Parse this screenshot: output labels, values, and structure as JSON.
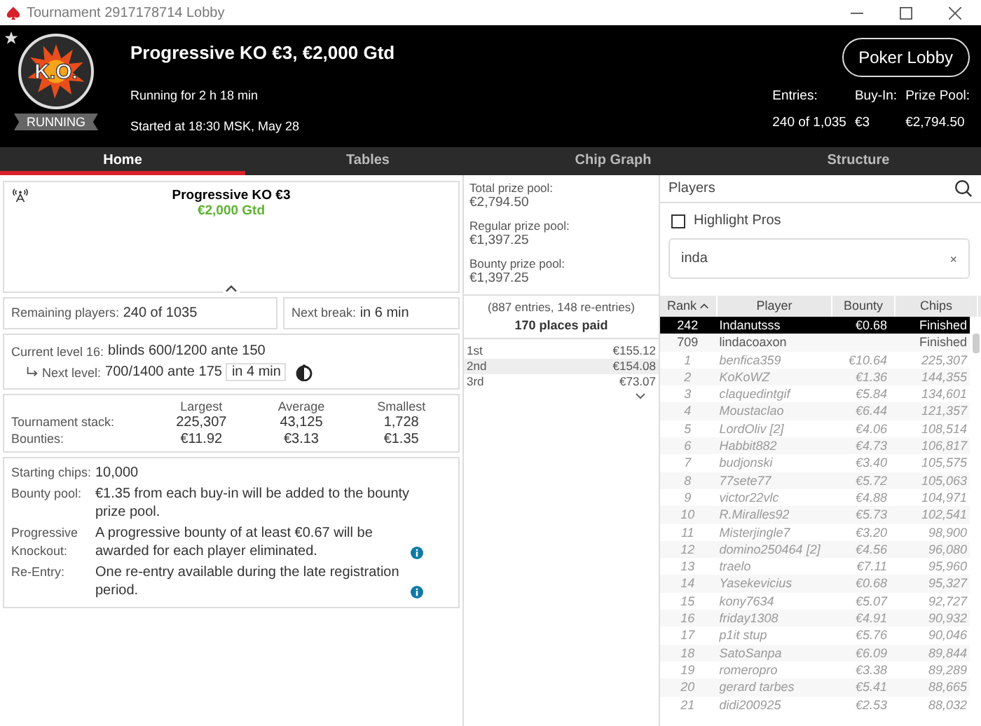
{
  "window": {
    "title": "Tournament 2917178714 Lobby"
  },
  "header": {
    "badge": "K.O.",
    "status": "RUNNING",
    "title": "Progressive KO €3, €2,000 Gtd",
    "running": "Running for 2 h 18 min",
    "started": "Started at 18:30 MSK, May 28",
    "lobby_button": "Poker Lobby",
    "stats": [
      {
        "label": "Entries:",
        "value": "240 of 1,035"
      },
      {
        "label": "Buy-In:",
        "value": "€3"
      },
      {
        "label": "Prize Pool:",
        "value": "€2,794.50"
      }
    ]
  },
  "tabs": [
    {
      "label": "Home",
      "selected": true
    },
    {
      "label": "Tables",
      "selected": false
    },
    {
      "label": "Chip Graph",
      "selected": false
    },
    {
      "label": "Structure",
      "selected": false
    }
  ],
  "summary": {
    "name": "Progressive KO €3",
    "guarantee": "€2,000 Gtd"
  },
  "remaining": {
    "label": "Remaining players:",
    "value": "240 of 1035"
  },
  "next_break": {
    "label": "Next break:",
    "value": "in 6 min"
  },
  "levels": {
    "current_label": "Current level 16:",
    "current_value": "blinds 600/1200 ante 150",
    "next_label": "Next level:",
    "next_value": "700/1400 ante 175",
    "next_time": "in 4 min"
  },
  "stacks": {
    "columns": [
      "Largest",
      "Average",
      "Smallest"
    ],
    "rows": [
      {
        "label": "Tournament stack:",
        "values": [
          "225,307",
          "43,125",
          "1,728"
        ]
      },
      {
        "label": "Bounties:",
        "values": [
          "€11.92",
          "€3.13",
          "€1.35"
        ]
      }
    ]
  },
  "info": [
    {
      "label": "Starting chips:",
      "text": "10,000",
      "info": false
    },
    {
      "label": "Bounty pool:",
      "text": "€1.35 from each buy-in will be added to the bounty prize pool.",
      "info": false
    },
    {
      "label": "Progressive Knockout:",
      "text": "A progressive bounty of at least €0.67 will be awarded for each player eliminated.",
      "info": true
    },
    {
      "label": "Re-Entry:",
      "text": "One re-entry available during the late registration period.",
      "info": true
    }
  ],
  "prize_pools": [
    {
      "label": "Total prize pool:",
      "value": "€2,794.50"
    },
    {
      "label": "Regular prize pool:",
      "value": "€1,397.25"
    },
    {
      "label": "Bounty prize pool:",
      "value": "€1,397.25"
    }
  ],
  "entries_note": "(887 entries, 148 re-entries)",
  "places_paid": "170 places paid",
  "payouts": [
    {
      "place": "1st",
      "amount": "€155.12"
    },
    {
      "place": "2nd",
      "amount": "€154.08"
    },
    {
      "place": "3rd",
      "amount": "€73.07"
    }
  ],
  "players": {
    "title": "Players",
    "highlight_pros": {
      "label": "Highlight Pros",
      "checked": false
    },
    "search": {
      "value": "inda",
      "clear": "×"
    },
    "columns": [
      "Rank",
      "Player",
      "Bounty",
      "Chips"
    ],
    "rows": [
      {
        "rank": "242",
        "player": "Indanutsss",
        "bounty": "€0.68",
        "chips": "Finished",
        "selected": true,
        "dimmed": false
      },
      {
        "rank": "709",
        "player": "lindacoaxon",
        "bounty": "",
        "chips": "Finished",
        "selected": false,
        "dimmed": false
      },
      {
        "rank": "1",
        "player": "benfica359",
        "bounty": "€10.64",
        "chips": "225,307",
        "selected": false,
        "dimmed": true
      },
      {
        "rank": "2",
        "player": "KoKoWZ",
        "bounty": "€1.36",
        "chips": "144,355",
        "selected": false,
        "dimmed": true
      },
      {
        "rank": "3",
        "player": "claquedintgif",
        "bounty": "€5.84",
        "chips": "134,601",
        "selected": false,
        "dimmed": true
      },
      {
        "rank": "4",
        "player": "Moustaclao",
        "bounty": "€6.44",
        "chips": "121,357",
        "selected": false,
        "dimmed": true
      },
      {
        "rank": "5",
        "player": "LordOliv [2]",
        "bounty": "€4.06",
        "chips": "108,514",
        "selected": false,
        "dimmed": true
      },
      {
        "rank": "6",
        "player": "Habbit882",
        "bounty": "€4.73",
        "chips": "106,817",
        "selected": false,
        "dimmed": true
      },
      {
        "rank": "7",
        "player": "budjonski",
        "bounty": "€3.40",
        "chips": "105,575",
        "selected": false,
        "dimmed": true
      },
      {
        "rank": "8",
        "player": "77sete77",
        "bounty": "€5.72",
        "chips": "105,063",
        "selected": false,
        "dimmed": true
      },
      {
        "rank": "9",
        "player": "victor22vlc",
        "bounty": "€4.88",
        "chips": "104,971",
        "selected": false,
        "dimmed": true
      },
      {
        "rank": "10",
        "player": "R.Miralles92",
        "bounty": "€5.73",
        "chips": "102,541",
        "selected": false,
        "dimmed": true
      },
      {
        "rank": "11",
        "player": "Misterjingle7",
        "bounty": "€3.20",
        "chips": "98,900",
        "selected": false,
        "dimmed": true
      },
      {
        "rank": "12",
        "player": "domino250464 [2]",
        "bounty": "€4.56",
        "chips": "96,080",
        "selected": false,
        "dimmed": true
      },
      {
        "rank": "13",
        "player": "traelo",
        "bounty": "€7.11",
        "chips": "95,960",
        "selected": false,
        "dimmed": true
      },
      {
        "rank": "14",
        "player": "Yasekevicius",
        "bounty": "€0.68",
        "chips": "95,327",
        "selected": false,
        "dimmed": true
      },
      {
        "rank": "15",
        "player": "kony7634",
        "bounty": "€5.07",
        "chips": "92,727",
        "selected": false,
        "dimmed": true
      },
      {
        "rank": "16",
        "player": "friday1308",
        "bounty": "€4.91",
        "chips": "90,932",
        "selected": false,
        "dimmed": true
      },
      {
        "rank": "17",
        "player": "p1it stup",
        "bounty": "€5.76",
        "chips": "90,046",
        "selected": false,
        "dimmed": true
      },
      {
        "rank": "18",
        "player": "SatoSanpa",
        "bounty": "€6.09",
        "chips": "89,844",
        "selected": false,
        "dimmed": true
      },
      {
        "rank": "19",
        "player": "romeropro",
        "bounty": "€3.38",
        "chips": "89,289",
        "selected": false,
        "dimmed": true
      },
      {
        "rank": "20",
        "player": "gerard tarbes",
        "bounty": "€5.41",
        "chips": "88,665",
        "selected": false,
        "dimmed": true
      },
      {
        "rank": "21",
        "player": "didi200925",
        "bounty": "€2.53",
        "chips": "88,032",
        "selected": false,
        "dimmed": true
      }
    ]
  }
}
